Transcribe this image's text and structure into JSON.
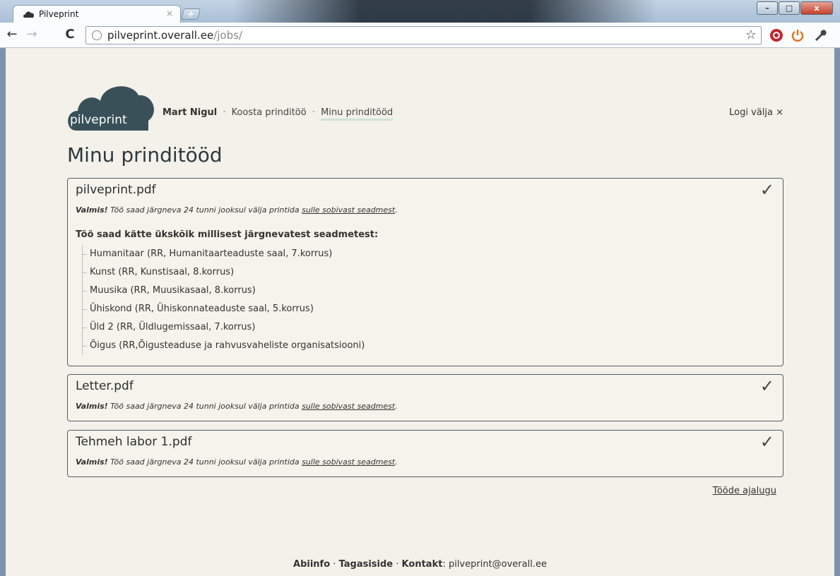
{
  "browser": {
    "tab_title": "Pilveprint",
    "tab_close": "×",
    "new_tab": "+",
    "url_host": "pilveprint.overall.ee",
    "url_path": "/jobs/",
    "back": "←",
    "forward": "→",
    "reload": "C",
    "star": "☆",
    "window_buttons": {
      "minimize": "–",
      "maximize": "□",
      "close": "x"
    }
  },
  "site": {
    "logo_text": "pilveprint",
    "user": "Mart Nigul",
    "nav": [
      {
        "label": "Koosta prinditöö"
      },
      {
        "label": "Minu prinditööd"
      }
    ],
    "separator": "·",
    "logout": "Logi välja ×"
  },
  "page": {
    "title": "Minu prinditööd",
    "status_bold": "Valmis!",
    "status_text": "Töö saad järgneva 24 tunni jooksul välja printida",
    "status_link": "sulle sobivast seadmest",
    "status_end": ".",
    "check": "✓",
    "devices_title": "Töö saad kätte ükskõik millisest järgnevatest seadmetest:",
    "jobs": [
      {
        "name": "pilveprint.pdf"
      },
      {
        "name": "Letter.pdf"
      },
      {
        "name": "Tehmeh labor 1.pdf"
      }
    ],
    "devices": [
      "Humanitaar (RR, Humanitaarteaduste saal, 7.korrus)",
      "Kunst (RR, Kunstisaal, 8.korrus)",
      "Muusika (RR, Muusikasaal, 8.korrus)",
      "Ühiskond (RR, Ühiskonnateaduste saal, 5.korrus)",
      "Üld 2 (RR, Üldlugemissaal, 7.korrus)",
      "Õigus (RR,Õigusteaduse ja rahvusvaheliste organisatsiooni)"
    ],
    "history_link": "Tööde ajalugu"
  },
  "footer": {
    "info": "Abiinfo",
    "feedback": "Tagasiside",
    "contact_label": "Kontakt",
    "contact_value": "pilveprint@overall.ee",
    "separator": "·"
  },
  "colors": {
    "page_bg": "#f4f1ea",
    "cloud": "#3a5058",
    "border": "#4f6066",
    "nav_underline": "#cfe2d9"
  }
}
